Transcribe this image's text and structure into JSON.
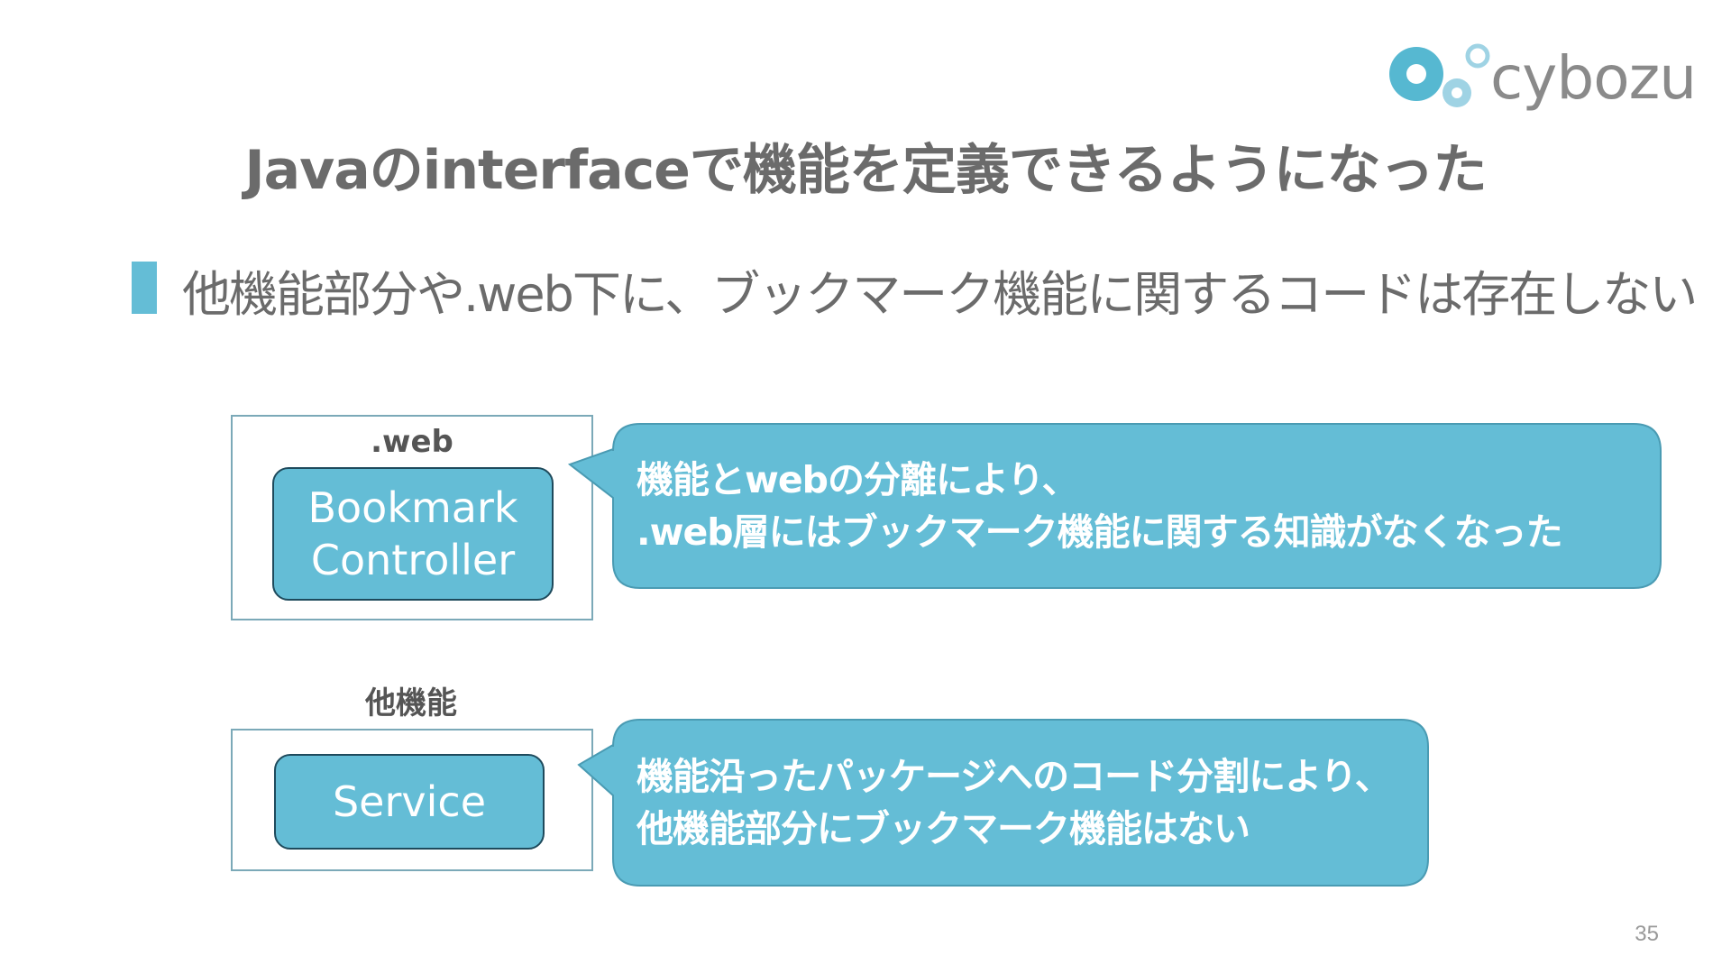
{
  "logo": {
    "text": "cybozu",
    "colors": {
      "primary": "#56b8d1",
      "light": "#9fd3e4",
      "text": "#8a8a8a"
    }
  },
  "slide": {
    "title": "Javaのinterfaceで機能を定義できるようになった",
    "bullet": "他機能部分や.web下に、ブックマーク機能に関するコードは存在しない",
    "page_number": "35"
  },
  "diagram": {
    "web_group": {
      "label": ".web",
      "component_lines": [
        "Bookmark",
        "Controller"
      ]
    },
    "other_group": {
      "label": "他機能",
      "component_lines": [
        "Service"
      ]
    }
  },
  "callouts": {
    "top": {
      "lines": [
        "機能とwebの分離により、",
        ".web層にはブックマーク機能に関する知識がなくなった"
      ]
    },
    "bottom": {
      "lines": [
        "機能沿ったパッケージへのコード分割により、",
        "他機能部分にブックマーク機能はない"
      ]
    }
  },
  "colors": {
    "accent": "#64bdd6",
    "callout_stroke": "#4a9bb3",
    "box_border": "#7ba9b8",
    "title": "#6b6b6b"
  }
}
